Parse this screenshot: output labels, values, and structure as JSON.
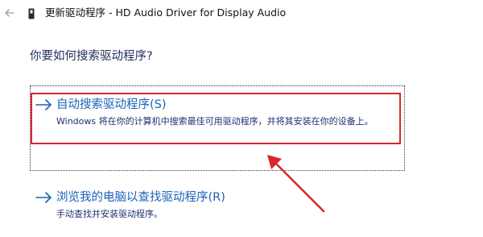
{
  "window": {
    "back_icon": "back-arrow-icon",
    "device_icon": "device-icon",
    "title": "更新驱动程序 - HD Audio Driver for Display Audio"
  },
  "main": {
    "question": "你要如何搜索驱动程序?",
    "options": [
      {
        "icon": "right-arrow-icon",
        "title": "自动搜索驱动程序(S)",
        "description": "Windows 将在你的计算机中搜索最佳可用驱动程序，并将其安装在你的设备上。"
      },
      {
        "icon": "right-arrow-icon",
        "title": "浏览我的电脑以查找驱动程序(R)",
        "description": "手动查找并安装驱动程序。"
      }
    ]
  },
  "colors": {
    "link_blue": "#1a62b8",
    "heading_navy": "#1e2f5a",
    "annotation_red": "#d8262c"
  }
}
